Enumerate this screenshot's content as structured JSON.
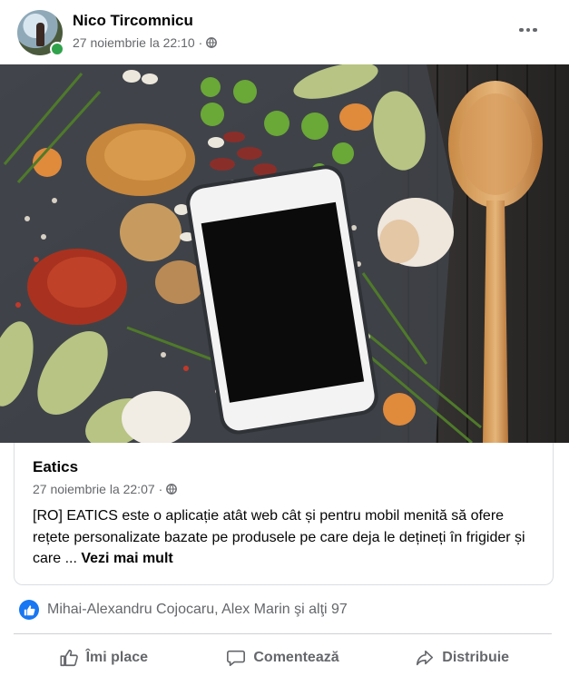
{
  "post": {
    "author": "Nico Tircomnicu",
    "timestamp": "27 noiembrie la 22:10",
    "separator": "·",
    "privacy_icon": "globe-icon",
    "more_icon": "more-options-icon"
  },
  "link_preview": {
    "title": "Eatics",
    "timestamp": "27 noiembrie la 22:07",
    "separator": "·",
    "text": "[RO] EATICS este o aplicație atât web cât și pentru mobil menită să ofere rețete personalizate bazate pe produsele pe care deja le dețineți în frigider și care ...",
    "see_more": "Vezi mai mult"
  },
  "reactions": {
    "icon": "like-icon",
    "summary": "Mihai-Alexandru Cojocaru, Alex Marin şi alţi 97"
  },
  "actions": {
    "like": "Îmi place",
    "comment": "Comentează",
    "share": "Distribuie"
  },
  "colors": {
    "accent": "#1877f2",
    "secondary_text": "#65676b",
    "online": "#31a24c"
  }
}
